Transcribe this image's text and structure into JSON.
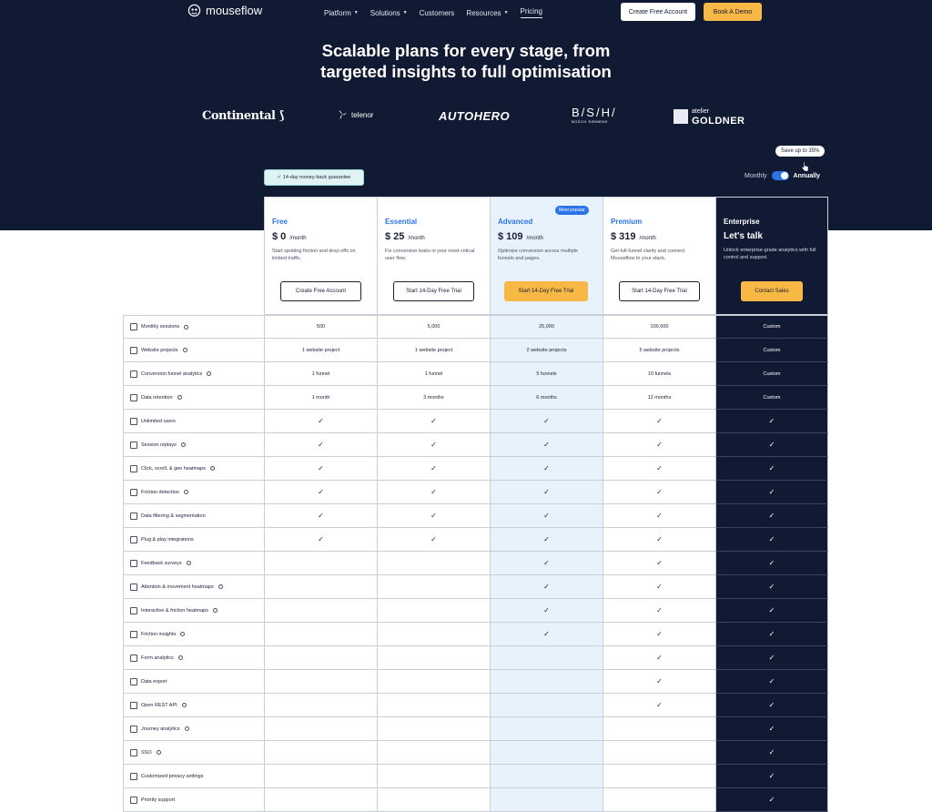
{
  "nav": {
    "logo": "mouseflow",
    "links": [
      {
        "label": "Platform",
        "dropdown": true
      },
      {
        "label": "Solutions",
        "dropdown": true
      },
      {
        "label": "Customers",
        "dropdown": false
      },
      {
        "label": "Resources",
        "dropdown": true
      },
      {
        "label": "Pricing",
        "dropdown": false,
        "active": true
      }
    ],
    "cta_primary": "Create Free Account",
    "cta_secondary": "Book A Demo"
  },
  "hero": {
    "title_line1": "Scalable plans for every stage, from",
    "title_line2": "targeted insights to full optimisation"
  },
  "brands": {
    "continental": "Continental",
    "telenor": "telenor",
    "autohero": "AUTOHERO",
    "bsh": "B/S/H/",
    "bsh_sub": "BOSCH  SIEMENS",
    "goldner_top": "atelier",
    "goldner_bottom": "GOLDNER"
  },
  "guarantee": "✓ 14-day money-back guarantee",
  "billing": {
    "save_badge": "Save up to 35%",
    "monthly": "Monthly",
    "annually": "Annually"
  },
  "popular_badge": "Most popular",
  "plans": [
    {
      "name": "Free",
      "price": "$ 0",
      "per": "/month",
      "desc": "Start spotting friction and drop-offs on limited traffic.",
      "cta": "Create Free Account"
    },
    {
      "name": "Essential",
      "price": "$ 25",
      "per": "/month",
      "desc": "Fix conversion leaks in your most critical user flow.",
      "cta": "Start 14-Day Free Trial"
    },
    {
      "name": "Advanced",
      "price": "$ 109",
      "per": "/month",
      "desc": "Optimize conversion across multiple funnels and pages.",
      "cta": "Start 14-Day Free Trial"
    },
    {
      "name": "Premium",
      "price": "$ 319",
      "per": "/month",
      "desc": "Get full-funnel clarity and connect Mouseflow to your stack.",
      "cta": "Start 14-Day Free Trial"
    },
    {
      "name": "Enterprise",
      "price": "Let's talk",
      "per": "",
      "desc": "Unlock enterprise-grade analytics with full control and support.",
      "cta": "Contact Sales"
    }
  ],
  "check": "✓",
  "features": [
    {
      "label": "Monthly sessions",
      "info": true,
      "values": [
        "500",
        "5,000",
        "25,000",
        "100,000",
        "Custom"
      ]
    },
    {
      "label": "Website projects",
      "info": true,
      "values": [
        "1 website project",
        "1 website project",
        "2 website projects",
        "5 website projects",
        "Custom"
      ]
    },
    {
      "label": "Conversion funnel analytics",
      "info": true,
      "values": [
        "1 funnel",
        "1 funnel",
        "5 funnels",
        "10 funnels",
        "Custom"
      ]
    },
    {
      "label": "Data retention",
      "info": true,
      "values": [
        "1 month",
        "3 months",
        "6 months",
        "12 months",
        "Custom"
      ]
    },
    {
      "label": "Unlimited users",
      "info": false,
      "values": [
        true,
        true,
        true,
        true,
        true
      ]
    },
    {
      "label": "Session replays",
      "info": true,
      "values": [
        true,
        true,
        true,
        true,
        true
      ]
    },
    {
      "label": "Click, scroll, & geo heatmaps",
      "info": true,
      "values": [
        true,
        true,
        true,
        true,
        true
      ]
    },
    {
      "label": "Friction detection",
      "info": true,
      "values": [
        true,
        true,
        true,
        true,
        true
      ]
    },
    {
      "label": "Data filtering & segmentation",
      "info": false,
      "values": [
        true,
        true,
        true,
        true,
        true
      ]
    },
    {
      "label": "Plug & play integrations",
      "info": false,
      "values": [
        true,
        true,
        true,
        true,
        true
      ]
    },
    {
      "label": "Feedback surveys",
      "info": true,
      "values": [
        false,
        false,
        true,
        true,
        true
      ]
    },
    {
      "label": "Attention & movement heatmaps",
      "info": true,
      "values": [
        false,
        false,
        true,
        true,
        true
      ]
    },
    {
      "label": "Interactive & friction heatmaps",
      "info": true,
      "values": [
        false,
        false,
        true,
        true,
        true
      ]
    },
    {
      "label": "Friction insights",
      "info": true,
      "values": [
        false,
        false,
        true,
        true,
        true
      ]
    },
    {
      "label": "Form analytics",
      "info": true,
      "values": [
        false,
        false,
        false,
        true,
        true
      ]
    },
    {
      "label": "Data export",
      "info": false,
      "values": [
        false,
        false,
        false,
        true,
        true
      ]
    },
    {
      "label": "Open REST API",
      "info": true,
      "values": [
        false,
        false,
        false,
        true,
        true
      ]
    },
    {
      "label": "Journey analytics",
      "info": true,
      "values": [
        false,
        false,
        false,
        false,
        true
      ]
    },
    {
      "label": "SSO",
      "info": true,
      "values": [
        false,
        false,
        false,
        false,
        true
      ]
    },
    {
      "label": "Customized privacy settings",
      "info": false,
      "values": [
        false,
        false,
        false,
        false,
        true
      ]
    },
    {
      "label": "Priority support",
      "info": false,
      "values": [
        false,
        false,
        false,
        false,
        true
      ]
    }
  ],
  "colors": {
    "navy": "#111a33",
    "accent_blue": "#2a73e8",
    "cta_yellow": "#f7b845",
    "highlight_col": "#e8f2fd"
  }
}
